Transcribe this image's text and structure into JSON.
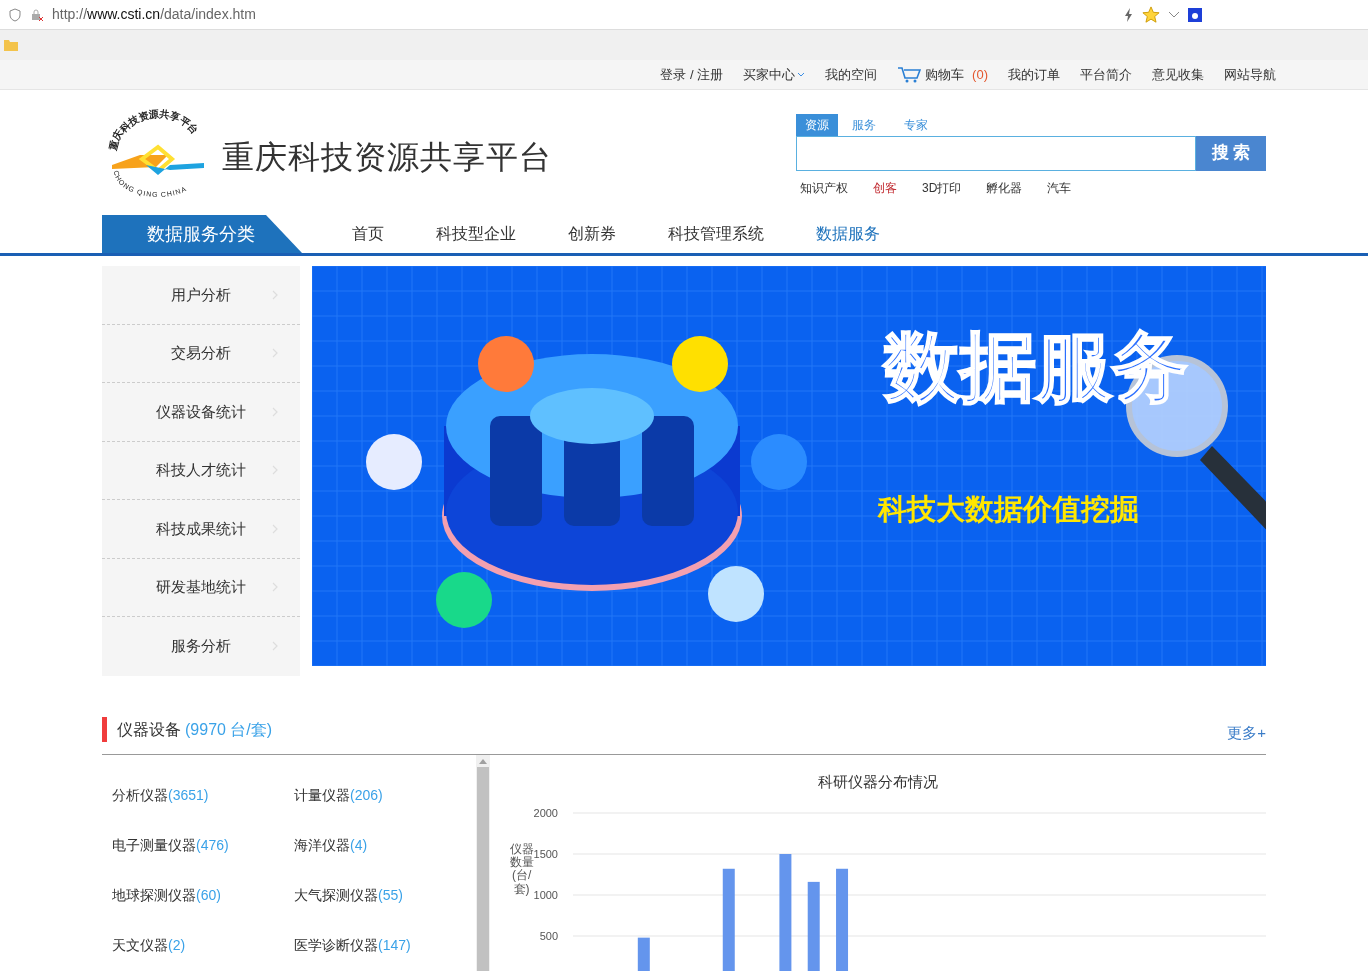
{
  "browser": {
    "url_prefix": "http://",
    "url_host": "www.csti.cn",
    "url_path": "/data/index.htm"
  },
  "top_links": [
    {
      "label": "登录 / 注册",
      "kind": "link"
    },
    {
      "label": "买家中心",
      "kind": "dropdown"
    },
    {
      "label": "我的空间",
      "kind": "link"
    },
    {
      "label": "购物车",
      "count": "(0)",
      "kind": "cart"
    },
    {
      "label": "我的订单",
      "kind": "link"
    },
    {
      "label": "平台简介",
      "kind": "link"
    },
    {
      "label": "意见收集",
      "kind": "link"
    },
    {
      "label": "网站导航",
      "kind": "link"
    }
  ],
  "logo": {
    "arc_text": "重庆科技资源共享平台",
    "bottom_text": "CHONG QING CHINA",
    "site_title": "重庆科技资源共享平台"
  },
  "search": {
    "tabs": [
      {
        "label": "资源",
        "selected": true
      },
      {
        "label": "服务",
        "selected": false
      },
      {
        "label": "专家",
        "selected": false
      }
    ],
    "button": "搜 索",
    "hot": [
      {
        "label": "知识产权",
        "highlight": false
      },
      {
        "label": "创客",
        "highlight": true
      },
      {
        "label": "3D打印",
        "highlight": false
      },
      {
        "label": "孵化器",
        "highlight": false
      },
      {
        "label": "汽车",
        "highlight": false
      }
    ]
  },
  "nav": {
    "category_tab": "数据服务分类",
    "items": [
      {
        "label": "首页",
        "selected": false
      },
      {
        "label": "科技型企业",
        "selected": false
      },
      {
        "label": "创新券",
        "selected": false
      },
      {
        "label": "科技管理系统",
        "selected": false
      },
      {
        "label": "数据服务",
        "selected": true
      }
    ]
  },
  "sidebar": {
    "items": [
      "用户分析",
      "交易分析",
      "仪器设备统计",
      "科技人才统计",
      "科技成果统计",
      "研发基地统计",
      "服务分析"
    ]
  },
  "banner": {
    "kind": "picture",
    "headline": "数据服务",
    "tagline": "科技大数据价值挖掘"
  },
  "section": {
    "title": "仪器设备",
    "total": "(9970 台/套)",
    "more": "更多+",
    "categories": [
      {
        "name": "分析仪器",
        "count": "(3651)"
      },
      {
        "name": "计量仪器",
        "count": "(206)"
      },
      {
        "name": "电子测量仪器",
        "count": "(476)"
      },
      {
        "name": "海洋仪器",
        "count": "(4)"
      },
      {
        "name": "地球探测仪器",
        "count": "(60)"
      },
      {
        "name": "大气探测仪器",
        "count": "(55)"
      },
      {
        "name": "天文仪器",
        "count": "(2)"
      },
      {
        "name": "医学诊断仪器",
        "count": "(147)"
      }
    ],
    "chart_data": {
      "type": "bar",
      "title": "科研仪器分布情况",
      "ylabel": "仪器数量(台/套)",
      "ylim": [
        0,
        2000
      ],
      "yticks": [
        500,
        1000,
        1500,
        2000
      ],
      "grid": true,
      "series": [
        {
          "color": "#6495ed",
          "values": [
            null,
            null,
            480,
            null,
            null,
            1320,
            null,
            1500,
            1160,
            1320,
            null,
            null,
            null,
            null,
            null,
            null,
            null,
            null,
            null,
            null,
            null,
            null,
            null,
            null,
            null
          ]
        }
      ]
    }
  }
}
